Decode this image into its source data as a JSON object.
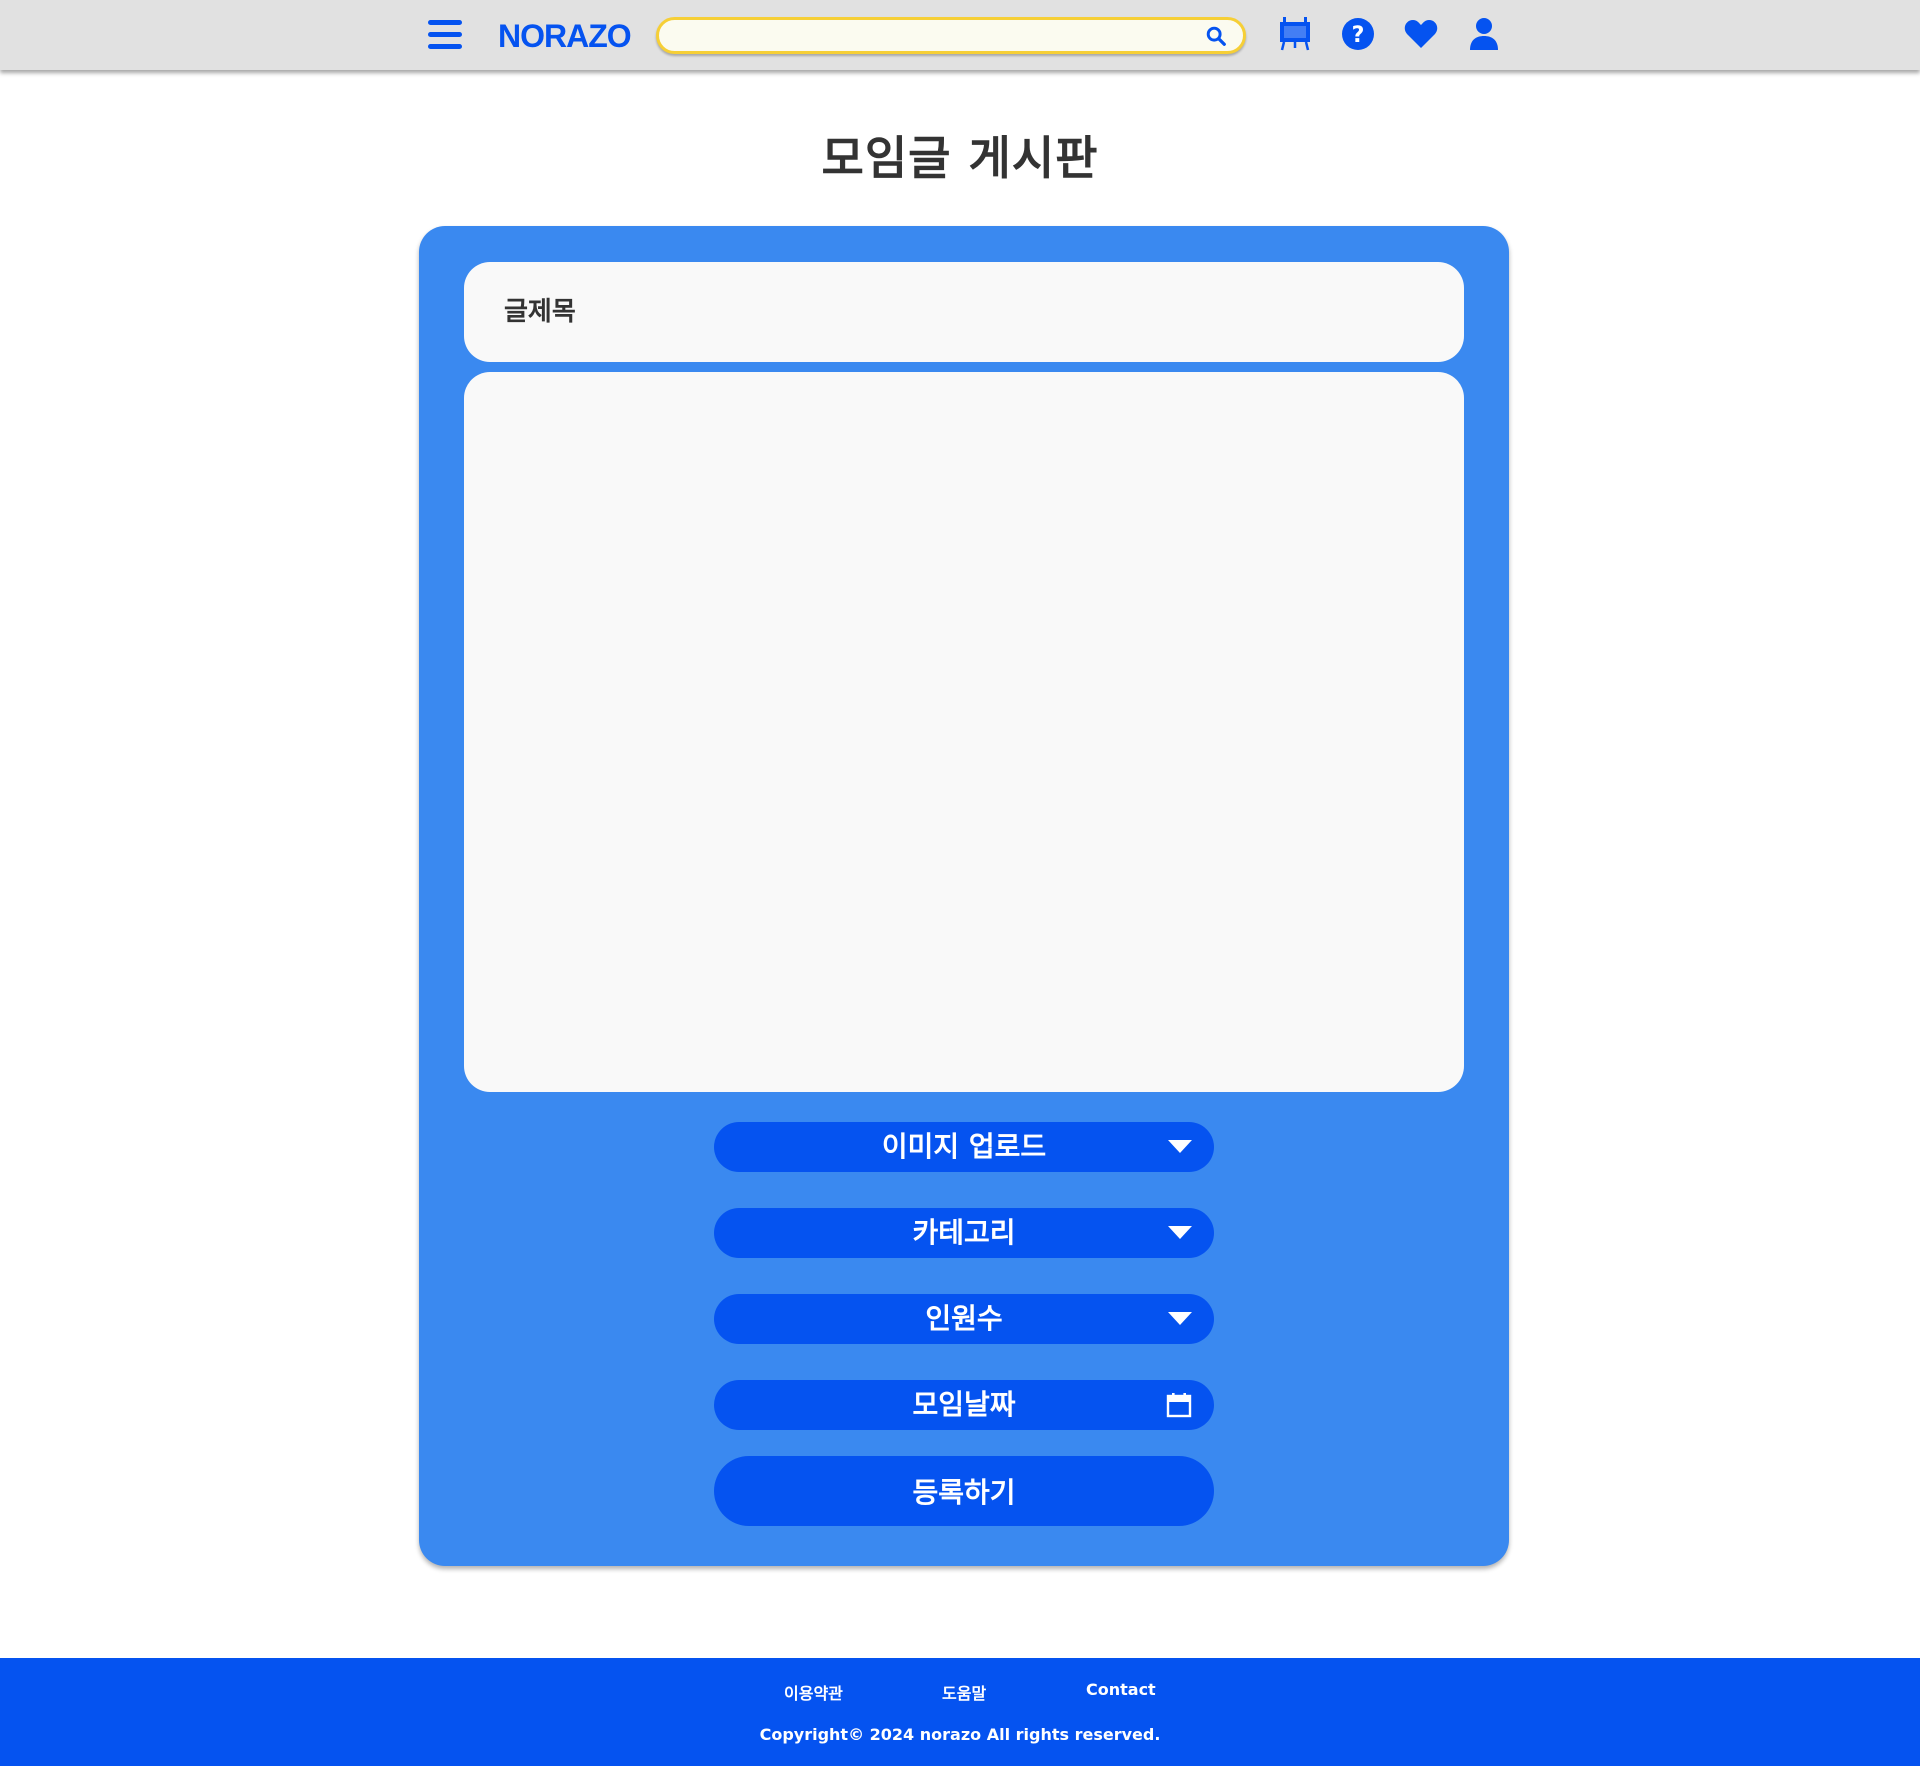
{
  "header": {
    "logo": "NORAZO",
    "search": {
      "value": "",
      "placeholder": ""
    },
    "icons": [
      "menu-icon",
      "search-icon",
      "board-icon",
      "help-icon",
      "heart-icon",
      "user-icon"
    ]
  },
  "page": {
    "title": "모임글 게시판"
  },
  "form": {
    "title_placeholder": "글제목",
    "content_value": "",
    "image_upload_label": "이미지 업로드",
    "category_label": "카테고리",
    "members_label": "인원수",
    "date_label": "모임날짜",
    "submit_label": "등록하기"
  },
  "footer": {
    "links": [
      "이용약관",
      "도움말",
      "Contact"
    ],
    "copyright": "Copyright© 2024 norazo All rights reserved."
  },
  "colors": {
    "primary": "#0553f0",
    "card": "#3a89f0",
    "search_border": "#f6cf36",
    "header_bg": "#e1e1e1",
    "field_bg": "#f9f9f9",
    "text_dark": "#333333"
  }
}
